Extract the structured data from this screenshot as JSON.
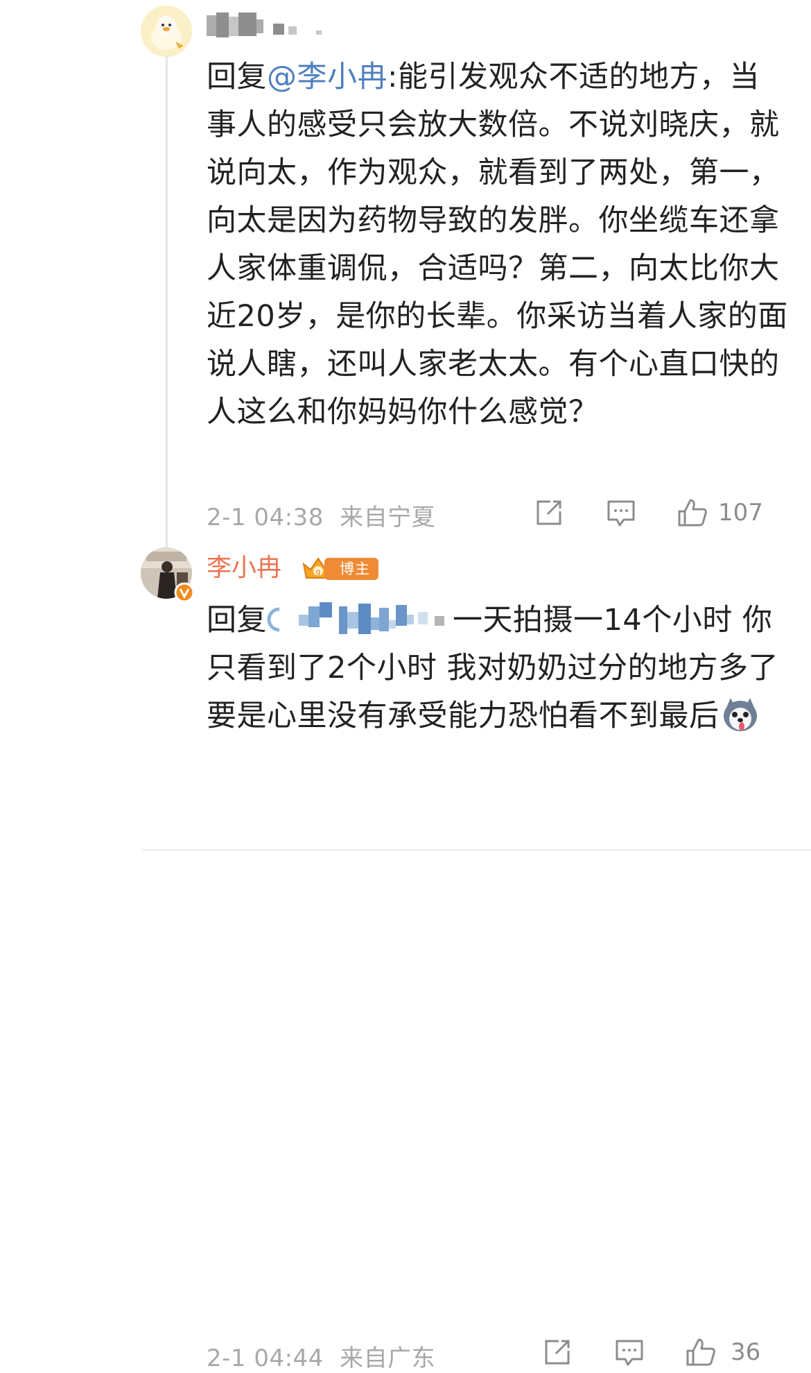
{
  "comments": [
    {
      "username": "",
      "reply_prefix": "回复",
      "mention": "@李小冉",
      "text": ":能引发观众不适的地方，当事人的感受只会放大数倍。不说刘晓庆，就说向太，作为观众，就看到了两处，第一，向太是因为药物导致的发胖。你坐缆车还拿人家体重调侃，合适吗？第二，向太比你大近20岁，是你的长辈。你采访当着人家的面说人瞎，还叫人家老太太。有个心直口快的人这么和你妈妈你什么感觉？",
      "time": "2-1 04:38",
      "location": "来自宁夏",
      "actions": {
        "share_icon": "share-icon",
        "comment_icon": "comment-icon",
        "like_icon": "like-icon",
        "like_count": "107"
      }
    },
    {
      "username": "李小冉",
      "badge": "博主",
      "reply_prefix": "回复",
      "text": "一天拍摄一14个小时 你只看到了2个小时 我对奶奶过分的地方多了 要是心里没有承受能力恐怕看不到最后",
      "time": "2-1 04:44",
      "location": "来自广东",
      "actions": {
        "share_icon": "share-icon",
        "comment_icon": "comment-icon",
        "like_icon": "like-icon",
        "like_count": "36"
      }
    }
  ],
  "colors": {
    "username": "#eb7350",
    "mention": "#4f7fc0",
    "badge": "#f08a35",
    "meta": "#a8a8a8"
  }
}
